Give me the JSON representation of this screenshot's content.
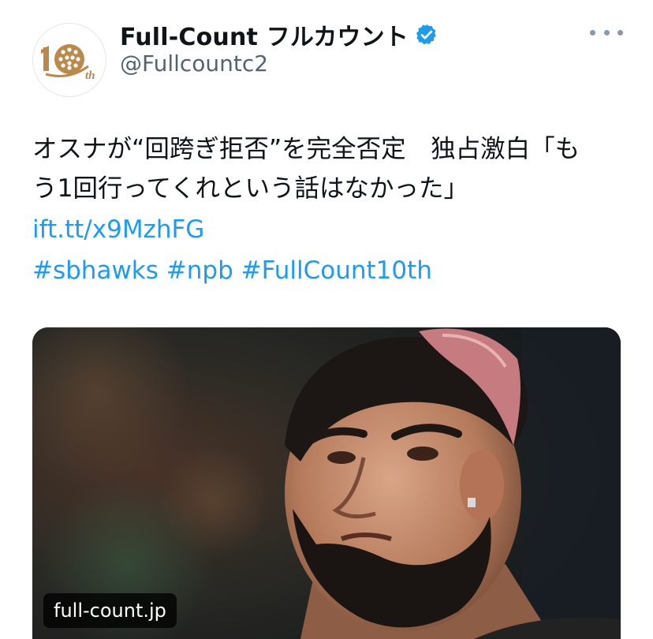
{
  "account": {
    "display_name": "Full-Count フルカウント",
    "handle": "@Fullcountc2",
    "verified": true,
    "avatar_text": "th",
    "avatar_icon": "full-count-10th-logo"
  },
  "header": {
    "more_icon": "more-horizontal-icon"
  },
  "tweet": {
    "text_lines": [
      "オスナが“回跨ぎ拒否”を完全否定　独占激白「も",
      "う1回行ってくれという話はなかった」"
    ],
    "short_link": "ift.tt/x9MzhFG",
    "hashtags": [
      "#sbhawks",
      "#npb",
      "#FullCount10th"
    ]
  },
  "card": {
    "image_description_icon": "player-photo",
    "domain": "full-count.jp"
  },
  "colors": {
    "link": "#1d9bf0",
    "verified": "#1d9bf0",
    "text": "#0f1419",
    "secondary": "#536471",
    "logo_gold": "#b98a4a"
  }
}
